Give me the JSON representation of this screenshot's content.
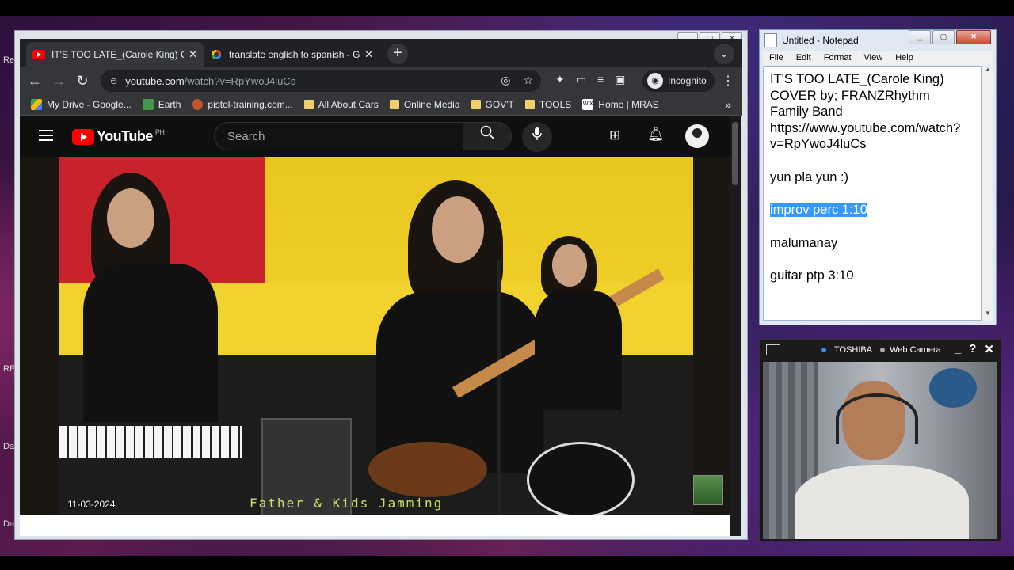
{
  "desktop": {
    "side_labels": [
      "Re",
      "RE",
      "Da",
      "Da"
    ]
  },
  "chrome": {
    "tabs": [
      {
        "title": "IT'S TOO LATE_(Carole King) COV",
        "favicon": "youtube-icon",
        "active": true
      },
      {
        "title": "translate english to spanish - Goo",
        "favicon": "google-icon",
        "active": false
      }
    ],
    "url_host": "youtube.com",
    "url_path": "/watch?v=RpYwoJ4luCs",
    "incognito_label": "Incognito",
    "bookmarks": [
      {
        "label": "My Drive - Google...",
        "icon": "google-drive-icon"
      },
      {
        "label": "Earth",
        "icon": "google-earth-icon"
      },
      {
        "label": "pistol-training.com...",
        "icon": "site-icon"
      },
      {
        "label": "All About Cars",
        "icon": "folder-icon"
      },
      {
        "label": "Online Media",
        "icon": "folder-icon"
      },
      {
        "label": "GOV'T",
        "icon": "folder-icon"
      },
      {
        "label": "TOOLS",
        "icon": "folder-icon"
      },
      {
        "label": "Home | MRAS",
        "icon": "wix-icon"
      }
    ]
  },
  "youtube": {
    "logo_text": "YouTube",
    "country_code": "PH",
    "search_placeholder": "Search",
    "video": {
      "watermark": "Father & Kids Jamming",
      "date": "11-03-2024"
    }
  },
  "notepad": {
    "title": "Untitled - Notepad",
    "menu": [
      "File",
      "Edit",
      "Format",
      "View",
      "Help"
    ],
    "lines": {
      "l1": "IT'S TOO LATE_(Carole King)",
      "l2": "COVER by; FRANZRhythm",
      "l3": "Family Band",
      "l4": "https://www.youtube.com/watch?",
      "l5": "v=RpYwoJ4luCs",
      "l6": "yun pla yun :)",
      "l7": "improv perc 1:10",
      "l8": "malumanay",
      "l9": "guitar ptp 3:10"
    }
  },
  "webcam": {
    "brand": "TOSHIBA",
    "label": "Web Camera"
  },
  "colors": {
    "youtube_red": "#ff0000",
    "chrome_dark": "#202124",
    "selection": "#3399ff"
  }
}
